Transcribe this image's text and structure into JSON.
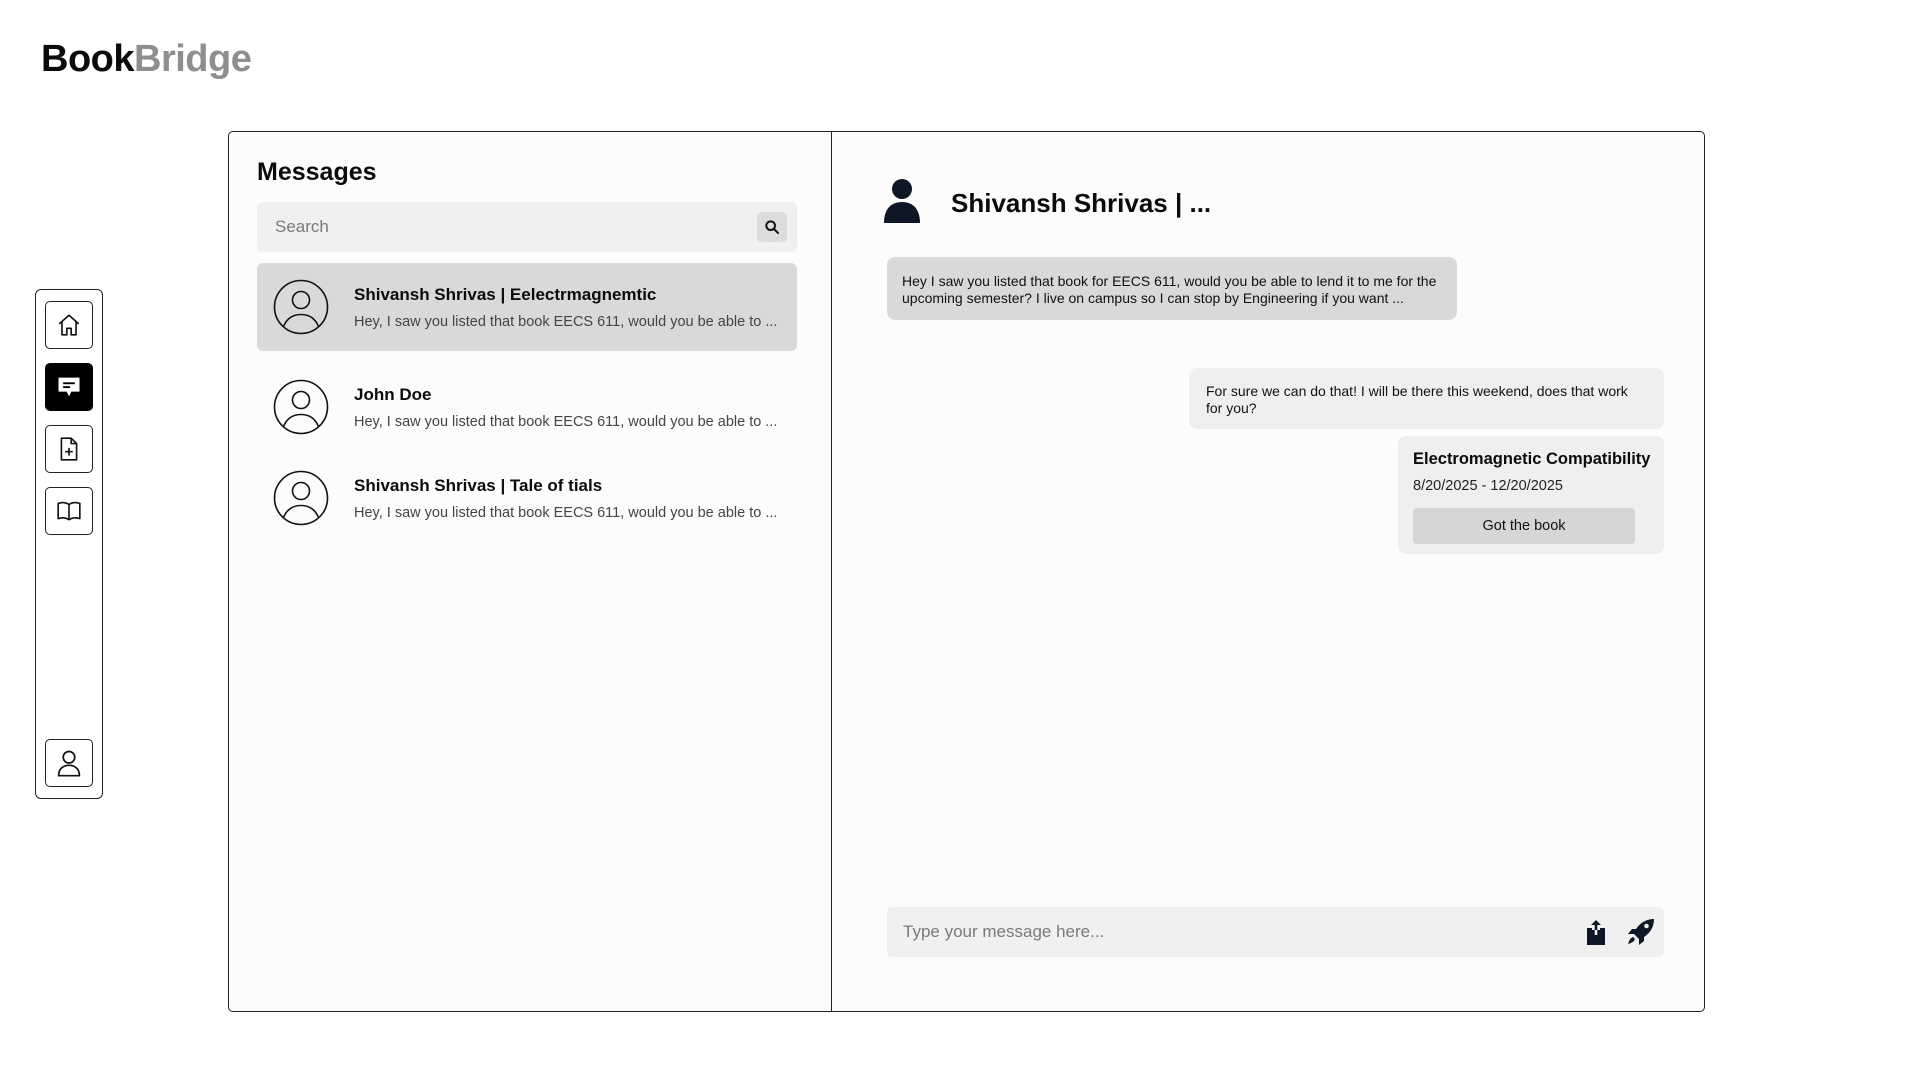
{
  "app": {
    "logo_part1": "Book",
    "logo_part2": "Bridge"
  },
  "sidebar": {
    "items": [
      {
        "id": "home",
        "icon": "home-icon",
        "active": false
      },
      {
        "id": "messages",
        "icon": "chat-icon",
        "active": true
      },
      {
        "id": "new-listing",
        "icon": "file-plus-icon",
        "active": false
      },
      {
        "id": "library",
        "icon": "book-open-icon",
        "active": false
      }
    ],
    "profile_icon": "user-icon"
  },
  "messages": {
    "title": "Messages",
    "search": {
      "placeholder": "Search",
      "value": ""
    },
    "conversations": [
      {
        "name": "Shivansh Shrivas | Eelectrmagnemtic",
        "preview": "Hey, I saw you listed that book EECS 611, would you be able to ...",
        "selected": true
      },
      {
        "name": "John Doe",
        "preview": "Hey, I saw you listed that book EECS 611, would you be able to ...",
        "selected": false
      },
      {
        "name": "Shivansh Shrivas | Tale of tials",
        "preview": "Hey, I saw you listed that book EECS 611, would you be able to ...",
        "selected": false
      }
    ]
  },
  "chat": {
    "title": "Shivansh Shrivas | ...",
    "incoming_message": "Hey I saw you listed that book for EECS 611, would you be able to lend it to me for the upcoming semester? I live on campus so I can stop by Engineering if you want ...",
    "outgoing_message": "For sure we can do that! I will be there this weekend, does that work for you?",
    "book_card": {
      "title": "Electromagnetic Compatibility",
      "dates": "8/20/2025 - 12/20/2025",
      "button_label": "Got the book"
    },
    "composer": {
      "placeholder": "Type your message here...",
      "value": ""
    }
  },
  "colors": {
    "selected_row": "#d9d9d9",
    "search_bg": "#f0f0f0",
    "logo_secondary": "#8e8e8e",
    "frame_bg": "#fdfcfb"
  }
}
